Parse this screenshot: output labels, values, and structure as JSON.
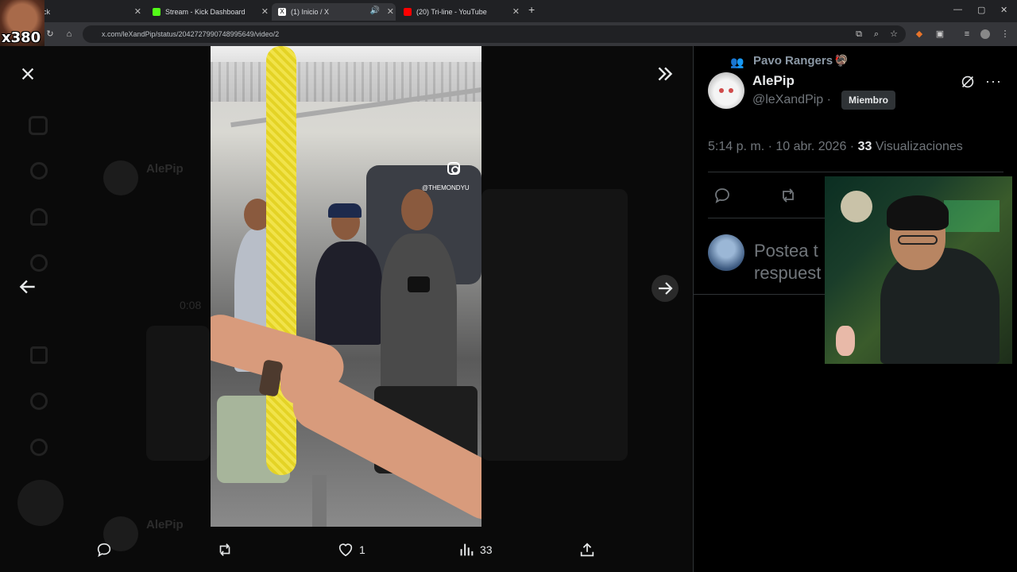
{
  "browser": {
    "tabs": [
      {
        "label": "ck",
        "active": false
      },
      {
        "label": "Stream - Kick Dashboard",
        "active": false
      },
      {
        "label": "(1) Inicio / X",
        "active": true
      },
      {
        "label": "(20) Tri-line - YouTube",
        "active": false
      }
    ],
    "url": "x.com/leXandPip/status/2042727990748995649/video/2"
  },
  "overlay": {
    "counter": "x380"
  },
  "media": {
    "watermark_handle": "@THEMONDYU",
    "actions": {
      "likes": "1",
      "views": "33"
    }
  },
  "post": {
    "community": "Pavo Rangers",
    "author_name": "AlePip",
    "author_handle": "@leXandPip",
    "separator": "·",
    "badge": "Miembro",
    "time": "5:14 p. m. · 10 abr. 2026 ·",
    "views_count": "33",
    "views_label": "Visualizaciones",
    "reply_placeholder_line1": "Postea t",
    "reply_placeholder_line2": "respuest"
  },
  "background_ghost": {
    "author": "AlePip",
    "author2": "AlePip",
    "time": "0:08"
  },
  "colors": {
    "accent": "#1d9bf0",
    "pole": "#e8d62c",
    "bg": "#000000"
  }
}
